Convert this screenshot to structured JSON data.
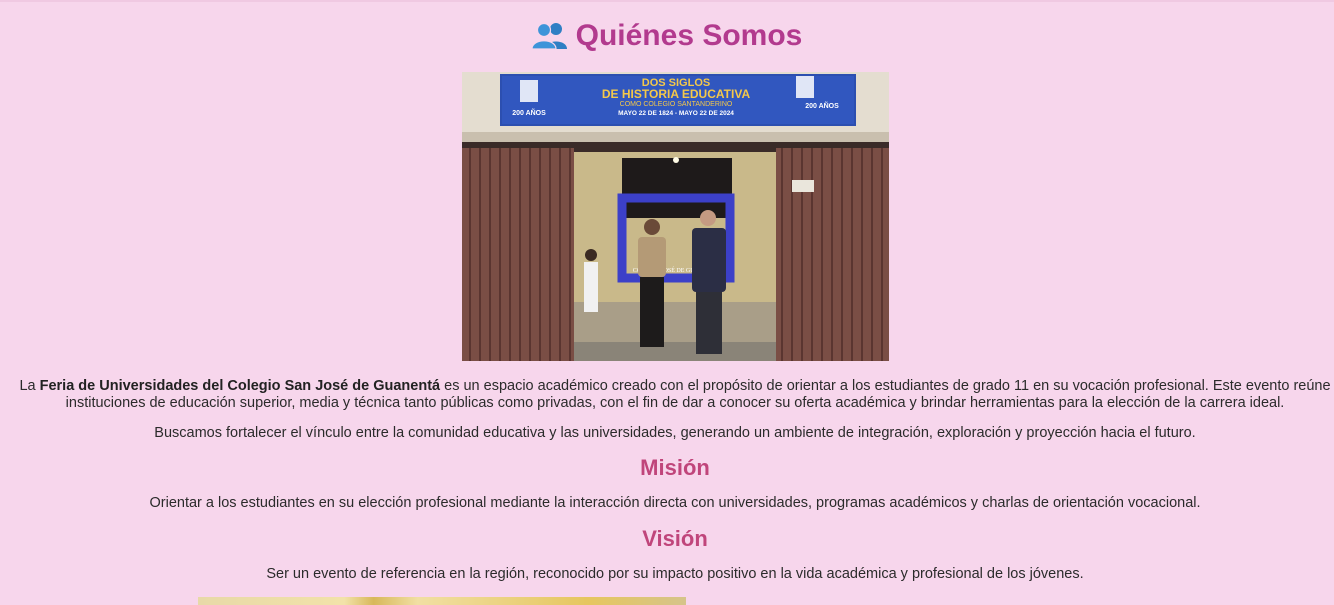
{
  "section": {
    "icon": "people-icon",
    "title": "Quiénes Somos"
  },
  "photo": {
    "banner_line1": "DOS SIGLOS",
    "banner_line2": "DE HISTORIA EDUCATIVA",
    "banner_line3": "COMO COLEGIO SANTANDERINO",
    "banner_line4": "MAYO 22 DE 1824 - MAYO 22 DE 2024",
    "badge_text": "200 AÑOS",
    "frame_caption": "COL. SAN JOSÉ DE GUANENTÁ"
  },
  "intro": {
    "prefix": "La ",
    "bold": "Feria de Universidades del Colegio San José de Guanentá",
    "rest": " es un espacio académico creado con el propósito de orientar a los estudiantes de grado 11 en su vocación profesional. Este evento reúne instituciones de educación superior, media y técnica tanto públicas como privadas, con el fin de dar a conocer su oferta académica y brindar herramientas para la elección de la carrera ideal."
  },
  "paragraph2": "Buscamos fortalecer el vínculo entre la comunidad educativa y las universidades, generando un ambiente de integración, exploración y proyección hacia el futuro.",
  "mision": {
    "heading": "Misión",
    "text": "Orientar a los estudiantes en su elección profesional mediante la interacción directa con universidades, programas académicos y charlas de orientación vocacional."
  },
  "vision": {
    "heading": "Visión",
    "text": "Ser un evento de referencia en la región, reconocido por su impacto positivo en la vida académica y profesional de los jóvenes."
  },
  "colors": {
    "background": "#f7d6ec",
    "title": "#b23a8e",
    "subheading": "#c0457b",
    "text": "#2b2b2b"
  }
}
